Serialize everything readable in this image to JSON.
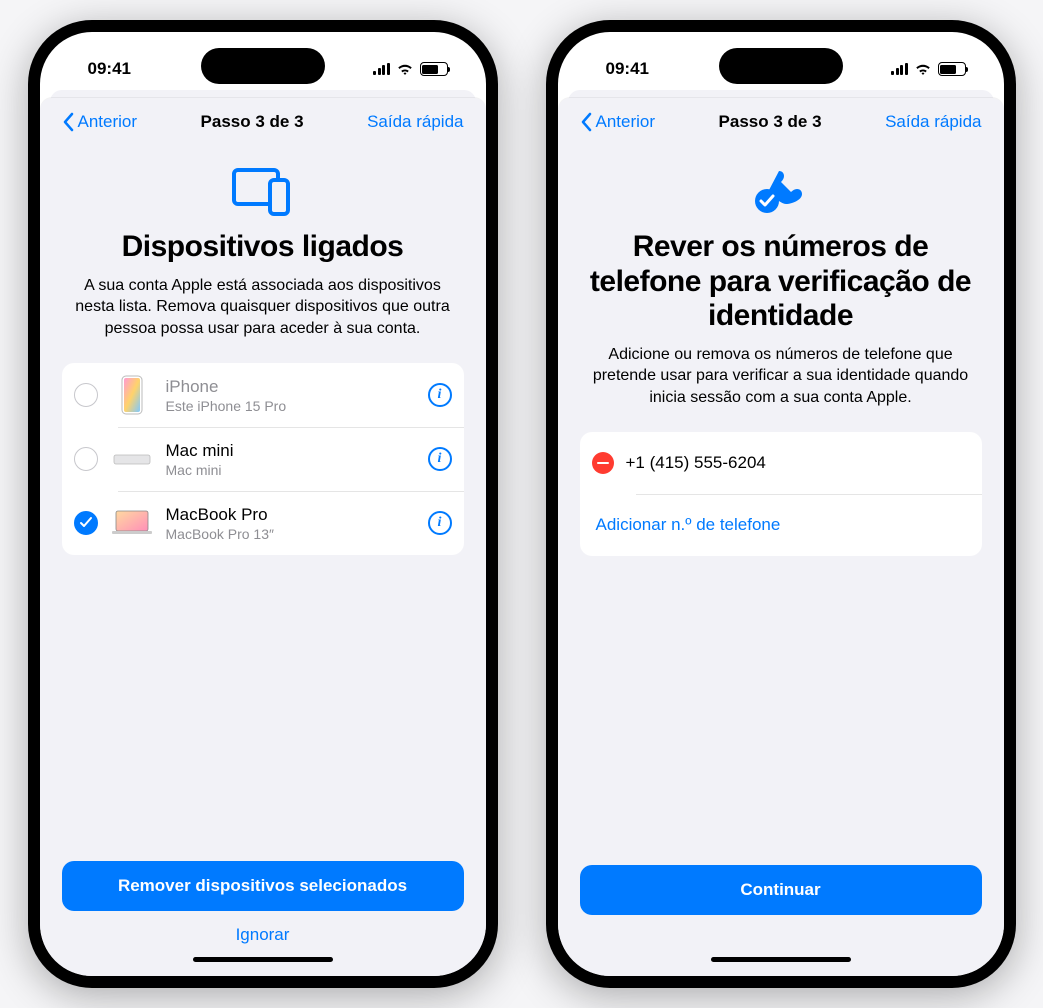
{
  "status": {
    "time": "09:41"
  },
  "nav": {
    "back": "Anterior",
    "title": "Passo 3 de 3",
    "quick_exit": "Saída rápida"
  },
  "left": {
    "title": "Dispositivos ligados",
    "desc": "A sua conta Apple está associada aos dispositivos nesta lista. Remova quaisquer dispositivos que outra pessoa possa usar para aceder à sua conta.",
    "devices": [
      {
        "name": "iPhone",
        "model": "Este iPhone 15 Pro",
        "selected": false,
        "current": true
      },
      {
        "name": "Mac mini",
        "model": "Mac mini",
        "selected": false,
        "current": false
      },
      {
        "name": "MacBook Pro",
        "model": "MacBook Pro 13″",
        "selected": true,
        "current": false
      }
    ],
    "primary": "Remover dispositivos selecionados",
    "skip": "Ignorar"
  },
  "right": {
    "title": "Rever os números de telefone para verificação de identidade",
    "desc": "Adicione ou remova os números de telefone que pretende usar para verificar a sua identidade quando inicia sessão com a sua conta Apple.",
    "phones": [
      {
        "number": "+1 (415) 555-6204"
      }
    ],
    "add_phone": "Adicionar n.º de telefone",
    "primary": "Continuar"
  }
}
